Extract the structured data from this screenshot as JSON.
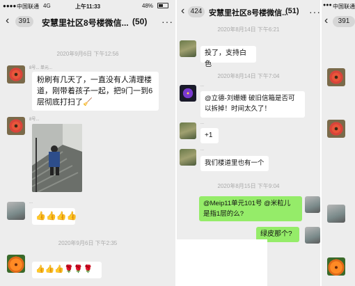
{
  "panel1": {
    "status": {
      "carrier": "中国联通",
      "network": "4G",
      "time": "上午11:33",
      "battery": "48%"
    },
    "nav": {
      "back_count": "391",
      "title": "安慧里社区8号楼微信...",
      "count": "(50)",
      "more": "···"
    },
    "time1": "2020年9月6日 下午12:56",
    "msg1_sender": "8号... 单元...",
    "msg1_text": "粉刷有几天了，一直没有人清理楼道，刚带着孩子一起，把9门一到6层彻底打扫了🧹",
    "msg2_sender": "8号...",
    "msg3_sender": "...",
    "msg3_emojis": "👍👍👍👍",
    "time2": "2020年9月6日 下午2:35",
    "msg4_emojis_thumbs": "👍👍👍",
    "msg4_emojis_roses": "🌹🌹🌹"
  },
  "panel2": {
    "nav": {
      "back_count": "424",
      "title": "安慧里社区8号楼微信...",
      "count": "(51)",
      "more": "···"
    },
    "time1": "2020年8月14日 下午6:21",
    "msg1_text": "投了，支持白色",
    "time2": "2020年8月14日 下午7:04",
    "msg2_sender": "...",
    "msg2_text": "@立德-刘姗姗 破旧信箱是否可以拆掉！时间太久了！",
    "msg3_sender": "...",
    "msg3_text": "+1",
    "msg4_sender": "...",
    "msg4_text": "我们楼道里也有一个",
    "time3": "2020年8月15日 下午9:04",
    "msg5_text": "@Meip11单元101号 @米粒儿 是指1层的么?",
    "msg6_text": "绿皮那个?"
  },
  "panel3": {
    "status": {
      "carrier": "中国联通"
    },
    "nav": {
      "back_count": "391"
    }
  }
}
